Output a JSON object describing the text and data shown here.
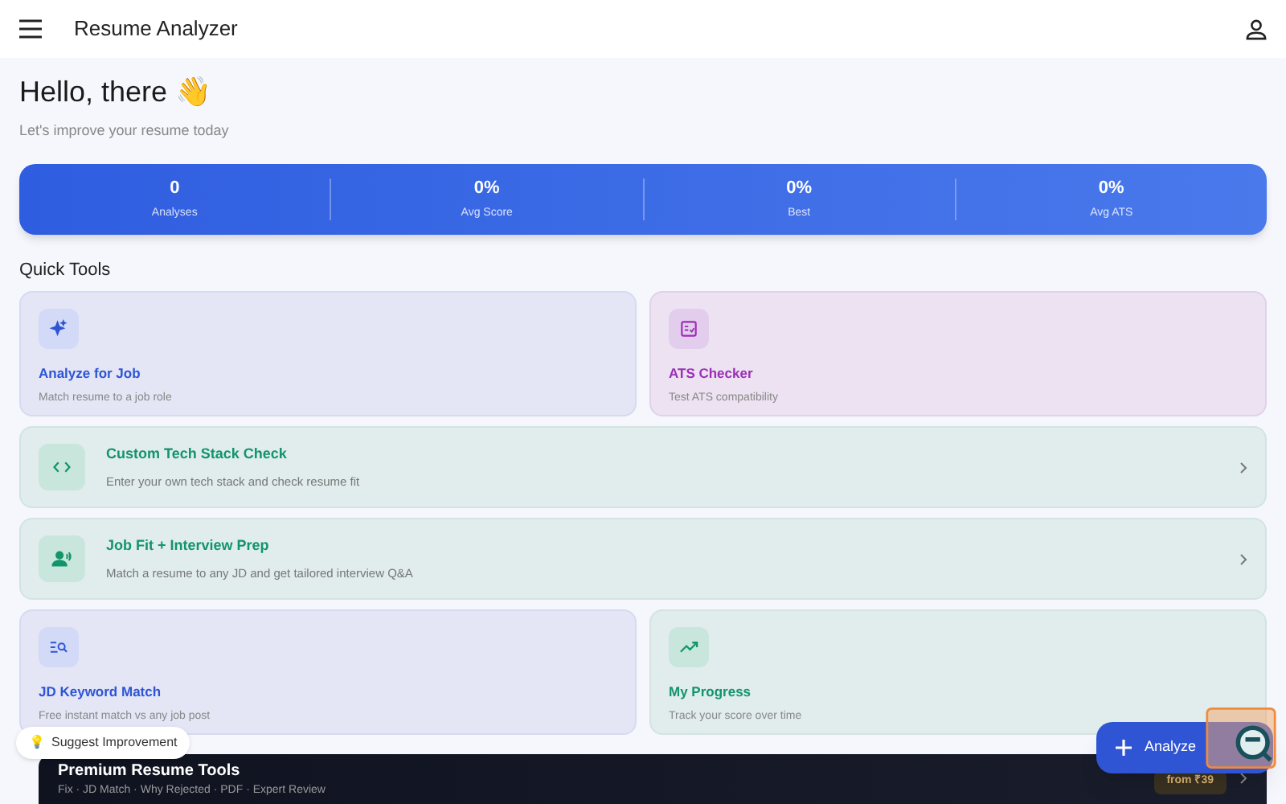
{
  "app_bar": {
    "title": "Resume Analyzer"
  },
  "greeting": {
    "title": "Hello, there 👋",
    "subtitle": "Let's improve your resume today"
  },
  "stats": [
    {
      "value": "0",
      "label": "Analyses"
    },
    {
      "value": "0%",
      "label": "Avg Score"
    },
    {
      "value": "0%",
      "label": "Best"
    },
    {
      "value": "0%",
      "label": "Avg ATS"
    }
  ],
  "section_title": "Quick Tools",
  "tools": [
    {
      "kind": "tile",
      "title": "Analyze for Job",
      "subtitle": "Match resume to a job role",
      "color": "#2f55d4"
    },
    {
      "kind": "tile",
      "title": "ATS Checker",
      "subtitle": "Test ATS compatibility",
      "color": "#9c2fb8"
    },
    {
      "kind": "wide",
      "title": "Custom Tech Stack Check",
      "subtitle": "Enter your own tech stack and check resume fit",
      "color": "#12956b"
    },
    {
      "kind": "wide",
      "title": "Job Fit + Interview Prep",
      "subtitle": "Match a resume to any JD and get tailored interview Q&A",
      "color": "#12956b"
    },
    {
      "kind": "tile",
      "title": "JD Keyword Match",
      "subtitle": "Free instant match vs any job post",
      "color": "#2f55d4"
    },
    {
      "kind": "tile",
      "title": "My Progress",
      "subtitle": "Track your score over time",
      "color": "#12956b"
    }
  ],
  "premium": {
    "title": "Premium Resume Tools",
    "subtitle": "Fix · JD Match · Why Rejected · PDF · Expert Review",
    "price": "from ₹39"
  },
  "suggest_button": {
    "icon": "💡",
    "label": "Suggest Improvement"
  },
  "fab": {
    "label": "Analyze"
  }
}
